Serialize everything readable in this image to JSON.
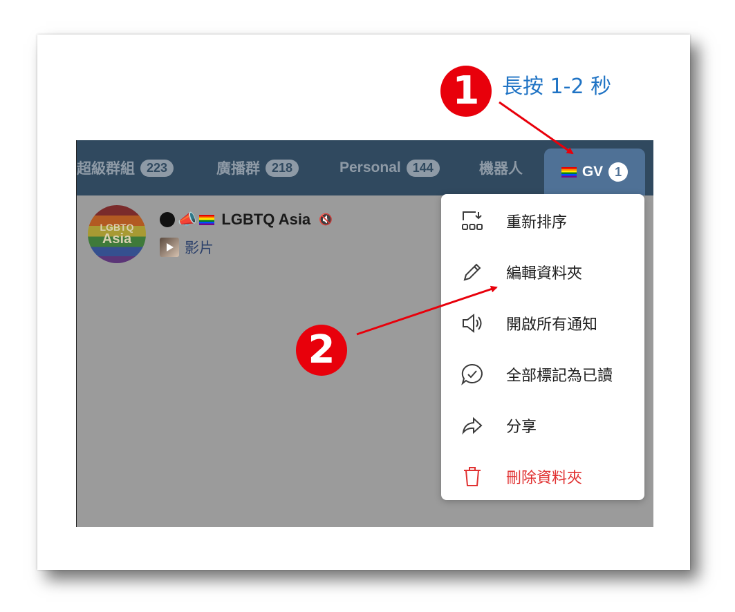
{
  "annotations": {
    "step1": "1",
    "step2": "2",
    "hint": "長按 1-2 秒"
  },
  "tabs": [
    {
      "label": "超級群組",
      "count": "223"
    },
    {
      "label": "廣播群",
      "count": "218"
    },
    {
      "label": "Personal",
      "count": "144"
    },
    {
      "label": "機器人"
    }
  ],
  "active_tab": {
    "label": "GV",
    "count": "1"
  },
  "chat": {
    "avatar_line1": "LGBTQ",
    "avatar_line2": "Asia",
    "title": "LGBTQ Asia",
    "subtitle": "影片"
  },
  "menu": {
    "items": [
      {
        "label": "重新排序",
        "icon": "reorder-icon"
      },
      {
        "label": "編輯資料夾",
        "icon": "pencil-icon"
      },
      {
        "label": "開啟所有通知",
        "icon": "speaker-icon"
      },
      {
        "label": "全部標記為已讀",
        "icon": "chat-check-icon"
      },
      {
        "label": "分享",
        "icon": "share-icon"
      },
      {
        "label": "刪除資料夾",
        "icon": "trash-icon",
        "danger": true
      }
    ]
  },
  "colors": {
    "marker_red": "#e8000b",
    "hint_blue": "#1f73c4",
    "tabbar": "#30495f",
    "active_tab": "#4f7196",
    "danger": "#e03131"
  }
}
